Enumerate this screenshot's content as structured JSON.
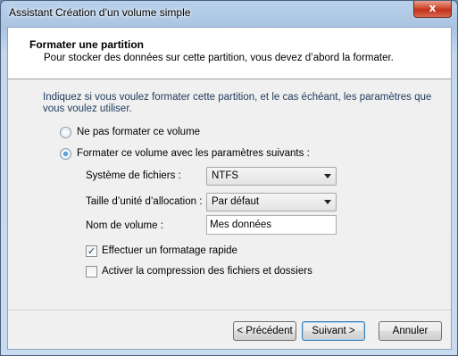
{
  "window": {
    "title": "Assistant Création d’un volume simple",
    "close_glyph": "x"
  },
  "header": {
    "title": "Formater une partition",
    "subtitle": "Pour stocker des données sur cette partition, vous devez d’abord la formater."
  },
  "intro": "Indiquez si vous voulez formater cette partition, et le cas échéant, les paramètres que vous voulez utiliser.",
  "options": {
    "no_format": {
      "label": "Ne pas formater ce volume",
      "selected": false
    },
    "format": {
      "label": "Formater ce volume avec les paramètres suivants :",
      "selected": true
    }
  },
  "fields": {
    "filesystem": {
      "label": "Système de fichiers :",
      "value": "NTFS"
    },
    "allocation": {
      "label": "Taille d’unité d’allocation :",
      "value": "Par défaut"
    },
    "volume_name": {
      "label": "Nom de volume :",
      "value": "Mes données"
    }
  },
  "checks": {
    "quick_format": {
      "label": "Effectuer un formatage rapide",
      "checked": true,
      "mark": "✓"
    },
    "compression": {
      "label": "Activer la compression des fichiers et dossiers",
      "checked": false
    }
  },
  "buttons": {
    "back": "< Précédent",
    "next": "Suivant >",
    "cancel": "Annuler"
  }
}
